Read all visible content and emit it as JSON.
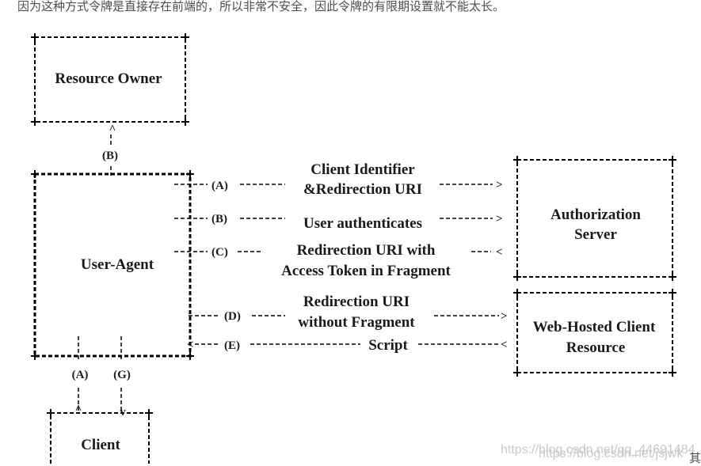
{
  "intro_text": "因为这种方式令牌是直接存在前端的，所以非常不安全，因此令牌的有限期设置就不能太长。",
  "tail_text": "其",
  "diagram": {
    "resource_owner": "Resource Owner",
    "user_agent": "User-Agent",
    "authorization_server": [
      "Authorization",
      "Server"
    ],
    "web_hosted": [
      "Web-Hosted Client",
      "Resource"
    ],
    "client": "Client",
    "step_b_top": "(B)",
    "flows": {
      "a": {
        "step": "(A)",
        "lines": [
          "Client Identifier",
          "&Redirection URI"
        ],
        "dir": ">"
      },
      "b": {
        "step": "(B)",
        "lines": [
          "User authenticates"
        ],
        "dir": ">"
      },
      "c": {
        "step": "(C)",
        "lines": [
          "Redirection URI with",
          "Access Token in Fragment"
        ],
        "dir": "<"
      },
      "d": {
        "step": "(D)",
        "lines": [
          "Redirection URI",
          "without Fragment"
        ],
        "dir": ">"
      },
      "e": {
        "step": "(E)",
        "lines": [
          "Script"
        ],
        "dir": "<"
      }
    },
    "step_a_bottom": "(A)",
    "step_g_bottom": "(G)"
  },
  "watermark": [
    "https://blog.csdn.net/qq_44691484",
    "https://blog.csdn.net/jsjwk"
  ]
}
